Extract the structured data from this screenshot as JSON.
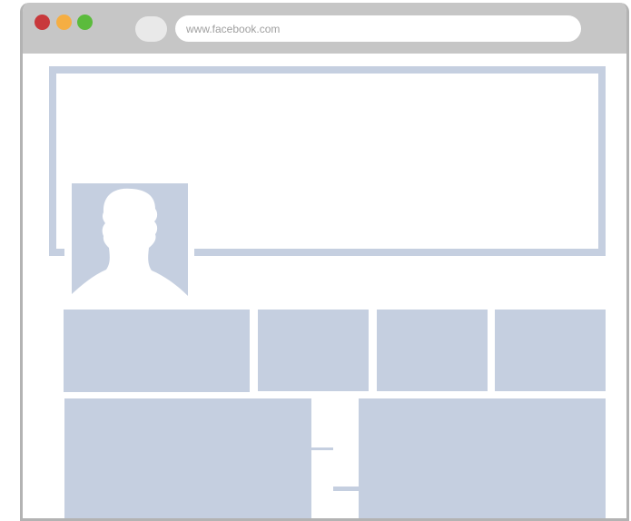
{
  "browser": {
    "url": "www.facebook.com",
    "traffic_lights": {
      "close": "#c8393c",
      "minimize": "#f5ae43",
      "maximize": "#5bbb3c"
    }
  },
  "page": {
    "accent_color": "#c5cfe0",
    "cover_photo": "placeholder",
    "profile_picture": "default-user-silhouette-icon"
  }
}
